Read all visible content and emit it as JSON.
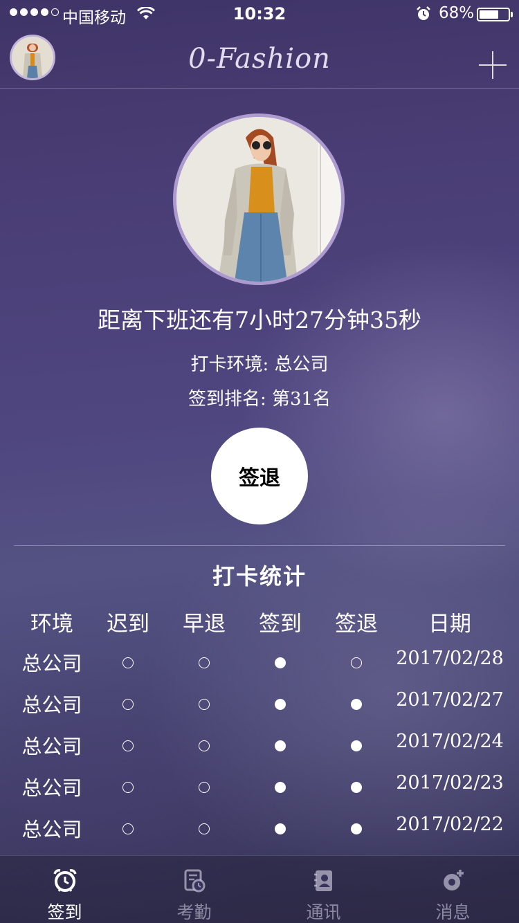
{
  "status_bar": {
    "carrier": "中国移动",
    "time": "10:32",
    "battery_percent": "68%",
    "battery_level": 0.68
  },
  "header": {
    "title": "0-Fashion"
  },
  "profile": {
    "countdown": "距离下班还有7小时27分钟35秒",
    "env_label": "打卡环境:",
    "env_value": "总公司",
    "rank_label": "签到排名:",
    "rank_value": "第31名"
  },
  "action": {
    "signout_label": "签退"
  },
  "stats": {
    "title": "打卡统计",
    "columns": [
      "环境",
      "迟到",
      "早退",
      "签到",
      "签退",
      "日期"
    ],
    "rows": [
      {
        "env": "总公司",
        "late": false,
        "early": false,
        "checkin": true,
        "checkout": false,
        "date": "2017/02/28"
      },
      {
        "env": "总公司",
        "late": false,
        "early": false,
        "checkin": true,
        "checkout": true,
        "date": "2017/02/27"
      },
      {
        "env": "总公司",
        "late": false,
        "early": false,
        "checkin": true,
        "checkout": true,
        "date": "2017/02/24"
      },
      {
        "env": "总公司",
        "late": false,
        "early": false,
        "checkin": true,
        "checkout": true,
        "date": "2017/02/23"
      },
      {
        "env": "总公司",
        "late": false,
        "early": false,
        "checkin": true,
        "checkout": true,
        "date": "2017/02/22"
      }
    ]
  },
  "tabs": [
    {
      "label": "签到",
      "icon": "alarm-clock-icon",
      "active": true
    },
    {
      "label": "考勤",
      "icon": "attendance-icon",
      "active": false
    },
    {
      "label": "通讯",
      "icon": "contacts-icon",
      "active": false
    },
    {
      "label": "消息",
      "icon": "message-icon",
      "active": false
    }
  ]
}
